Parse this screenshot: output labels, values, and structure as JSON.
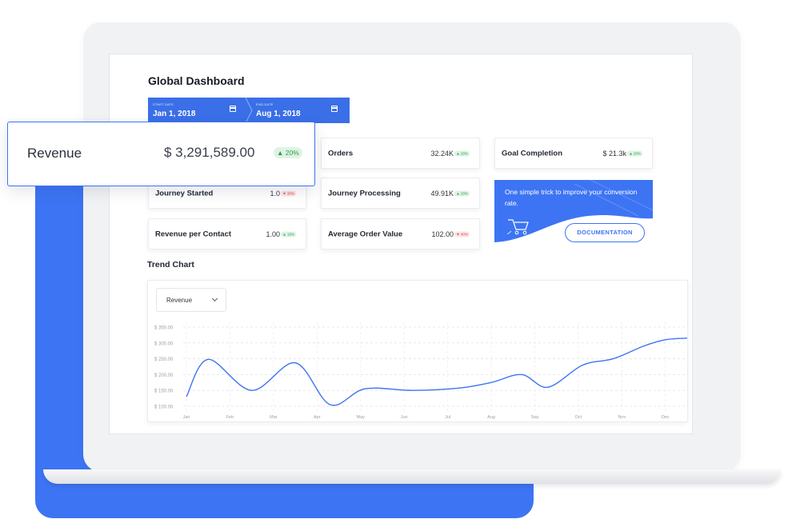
{
  "dashboard": {
    "title": "Global Dashboard",
    "start_date": {
      "label": "START DATE",
      "value": "Jan 1, 2018",
      "icon": "calendar-icon"
    },
    "end_date": {
      "label": "END DATE",
      "value": "Aug 1, 2018",
      "icon": "calendar-icon"
    }
  },
  "revenue": {
    "name": "Revenue",
    "value": "$ 3,291,589.00",
    "change": "▲ 20%",
    "trend": "up"
  },
  "metrics": [
    {
      "name": "Orders",
      "value": "32.24K",
      "change": "▲ 20%",
      "trend": "up"
    },
    {
      "name": "Goal Completion",
      "value": "$ 21.3k",
      "change": "▲ 20%",
      "trend": "up"
    },
    {
      "name": "Journey Started",
      "value": "1.0",
      "change": "▼ 30%",
      "trend": "down"
    },
    {
      "name": "Journey Processing",
      "value": "49.91K",
      "change": "▲ 20%",
      "trend": "up"
    },
    {
      "name": "Revenue per Contact",
      "value": "1.00",
      "change": "▲ 15%",
      "trend": "up"
    },
    {
      "name": "Average Order Value",
      "value": "102.00",
      "change": "▼ 40%",
      "trend": "down"
    }
  ],
  "promo": {
    "text": "One simple trick to improve your conversion rate.",
    "button_label": "DOCUMENTATION",
    "illustration_icon": "shopping-cart-icon"
  },
  "trend": {
    "title": "Trend Chart",
    "selector_value": "Revenue",
    "selector_icon": "chevron-down-icon"
  },
  "colors": {
    "accent": "#3d74f4",
    "up": "#2f9c4c",
    "down": "#d64545"
  },
  "chart_data": {
    "type": "line",
    "title": "",
    "xlabel": "",
    "ylabel": "",
    "categories": [
      "Jan",
      "Feb",
      "Mar",
      "Apr",
      "May",
      "Jun",
      "Jul",
      "Aug",
      "Sep",
      "Oct",
      "Nov",
      "Dec"
    ],
    "y_tick_labels": [
      "$ 350.00",
      "$ 300.00",
      "$ 250.00",
      "$ 200.00",
      "$ 150.00",
      "$ 100.00"
    ],
    "ylim": [
      100,
      350
    ],
    "grid": true,
    "series": [
      {
        "x": [
          0,
          0.5,
          1.5,
          2.5,
          3.3,
          4.1,
          5.2,
          6.3,
          7.0,
          7.7,
          8.3,
          9.1,
          9.8,
          10.5,
          11.0,
          11.5
        ],
        "values": [
          130,
          248,
          150,
          237,
          105,
          155,
          150,
          158,
          175,
          200,
          160,
          230,
          250,
          290,
          310,
          315
        ]
      }
    ]
  }
}
